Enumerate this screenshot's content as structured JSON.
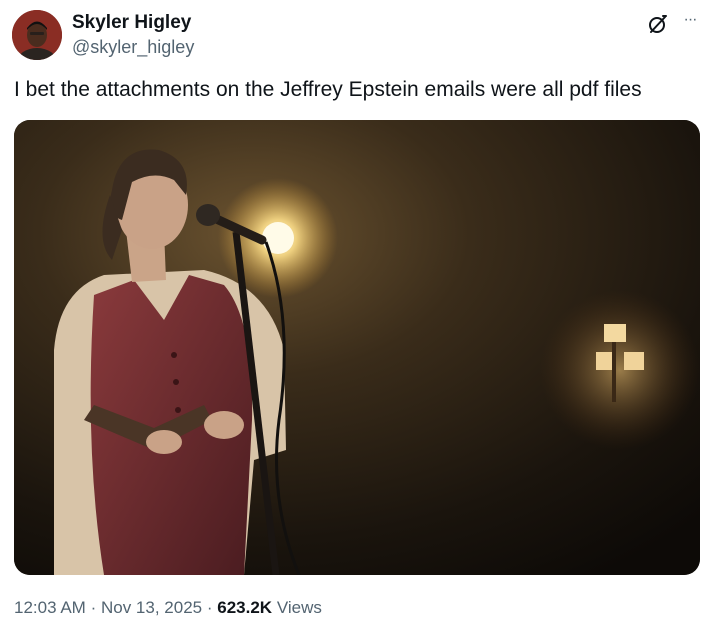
{
  "user": {
    "display_name": "Skyler Higley",
    "handle": "@skyler_higley",
    "avatar_icon": "profile-photo"
  },
  "actions": {
    "grok_icon": "grok-icon",
    "more_icon": "more-options-icon",
    "more_glyph": "···"
  },
  "tweet": {
    "text": "I bet the attachments on the Jeffrey Epstein emails were all pdf files"
  },
  "media": {
    "type": "photo"
  },
  "meta": {
    "time": "12:03 AM",
    "separator": "·",
    "date": "Nov 13, 2025",
    "views_count": "623.2K",
    "views_label": "Views"
  },
  "colors": {
    "text_primary": "#0f1419",
    "text_secondary": "#536471",
    "background": "#ffffff"
  }
}
